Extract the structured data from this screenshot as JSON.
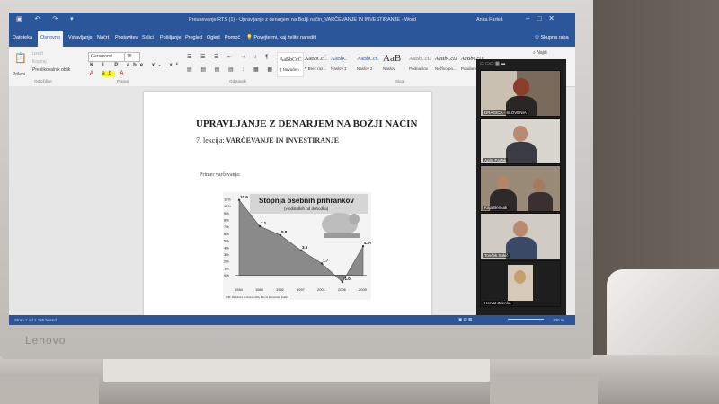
{
  "word": {
    "title": "Preusevanje RTS (1) - Upravljanje z denarjem na Božji način_VARČEVANJE IN INVESTIRANJE - Word",
    "user": "Anita Fartek",
    "search_tell_me": "Povejte mi, kaj želite narediti",
    "share_label": "Skupna raba",
    "tabs": [
      "Datoteka",
      "Osnovno",
      "Vstavljanje",
      "Načrt",
      "Postavitev",
      "Sklici",
      "Pošiljanje",
      "Pregled",
      "Ogled",
      "Pomoč"
    ],
    "clipboard": {
      "paste": "Prilepi",
      "cut": "Izreži",
      "copy": "Kopiraj",
      "format_painter": "Preslikovalnik oblik",
      "group": "Odložišče"
    },
    "font": {
      "name": "Garamond",
      "size": "18",
      "group": "Pisava"
    },
    "paragraph_group": "Odstavek",
    "styles_group": "Slogi",
    "styles": [
      {
        "sample": "AaBbCcĆ",
        "label": "¶ Navaden"
      },
      {
        "sample": "AaBbCcĆ",
        "label": "¶ Brez raz..."
      },
      {
        "sample": "AaBbC",
        "label": "Naslov 1"
      },
      {
        "sample": "AaBbCcĆ",
        "label": "Naslov 2"
      },
      {
        "sample": "AaB",
        "label": "Naslov"
      },
      {
        "sample": "AaBbCcD",
        "label": "Podnaslov"
      },
      {
        "sample": "AaBbCcD",
        "label": "Neživo po..."
      },
      {
        "sample": "AaBbCcD",
        "label": "Poudarek"
      }
    ],
    "find_label": "Najdi",
    "status_left": "Stran 1 od 1   185 besed",
    "zoom": "100 %"
  },
  "document": {
    "title": "UPRAVLJANJE Z DENARJEM NA BOŽJI NAČIN",
    "lesson_prefix": "7. lekcija:",
    "lesson_title": "VARČEVANJE IN INVESTIRANJE",
    "example_label": "Primer varčevanja:"
  },
  "chart_data": {
    "type": "area",
    "title": "Stopnja osebnih prihrankov",
    "subtitle": "(v odstotkih od dohodka)",
    "x": [
      1984,
      1988,
      1992,
      1997,
      2001,
      2006,
      2009
    ],
    "values": [
      10.9,
      7.1,
      5.8,
      3.6,
      1.7,
      -1.0,
      4.2
    ],
    "data_labels": [
      "10.9",
      "7.1",
      "5.8",
      "3.6",
      "1.7",
      "-1.0",
      "4.2%"
    ],
    "y_ticks": [
      "11%",
      "10%",
      "9%",
      "8%",
      "7%",
      "6%",
      "5%",
      "4%",
      "3%",
      "2%",
      "1%",
      "0%"
    ],
    "ylim": [
      -1.5,
      11
    ],
    "source_note": "VIR: Ministrstvo za finance ZDA, Biro za ekonomsko analizo"
  },
  "zoom_participants": [
    {
      "name": "DRAGICA - SLOVENIA"
    },
    {
      "name": "Anita Fartek"
    },
    {
      "name": "Kaja Bencak"
    },
    {
      "name": "Tonček Sukič"
    },
    {
      "name": "Horvat Zdenka"
    }
  ],
  "brand": "Lenovo",
  "colors": {
    "word_blue": "#2b579a",
    "chart_area": "#8a8a8a"
  }
}
